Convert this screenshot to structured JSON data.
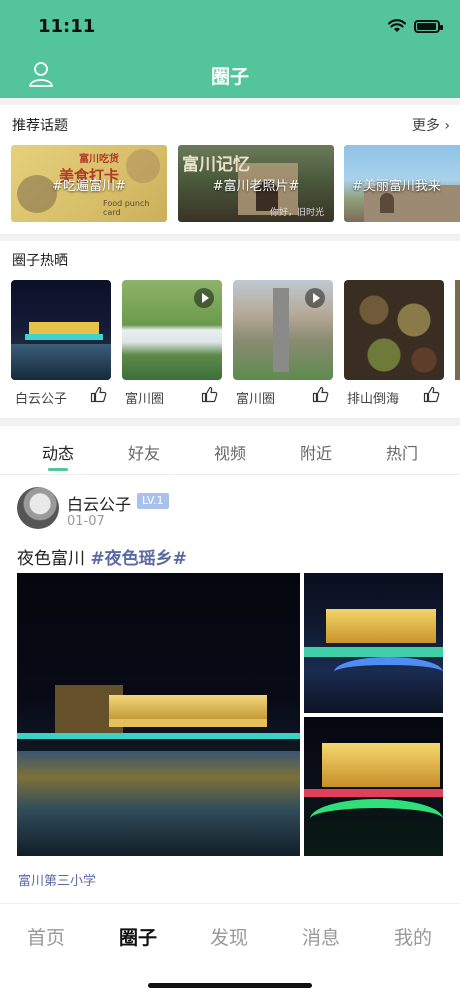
{
  "status_bar": {
    "time": "11:11"
  },
  "header": {
    "title": "圈子",
    "user_icon": "user-outline-icon",
    "color": "#54c49a"
  },
  "topics": {
    "title": "推荐话题",
    "more_label": "更多 ›",
    "items": [
      {
        "label": "#吃遍富川#",
        "art_a": "富川吃货",
        "art_b": "美食打卡",
        "art_c": "Food punch card"
      },
      {
        "label": "#富川老照片#",
        "art_a": "富川记忆",
        "art_b": "你好，旧时光"
      },
      {
        "label": "#美丽富川我来"
      }
    ]
  },
  "hot": {
    "title": "圈子热晒",
    "items": [
      {
        "name": "白云公子",
        "video": false
      },
      {
        "name": "富川圈",
        "video": true
      },
      {
        "name": "富川圈",
        "video": true
      },
      {
        "name": "排山倒海",
        "video": false
      }
    ]
  },
  "feed_tabs": [
    "动态",
    "好友",
    "视频",
    "附近",
    "热门"
  ],
  "post": {
    "user": "白云公子",
    "level": "LV.1",
    "date": "01-07",
    "text": "夜色富川 ",
    "tag": "#夜色瑶乡#",
    "location": "富川第三小学"
  },
  "tabbar": [
    "首页",
    "圈子",
    "发现",
    "消息",
    "我的"
  ],
  "colors": {
    "accent": "#54c49a",
    "tag": "#5b6aa3",
    "badge": "#a9c2ec"
  }
}
